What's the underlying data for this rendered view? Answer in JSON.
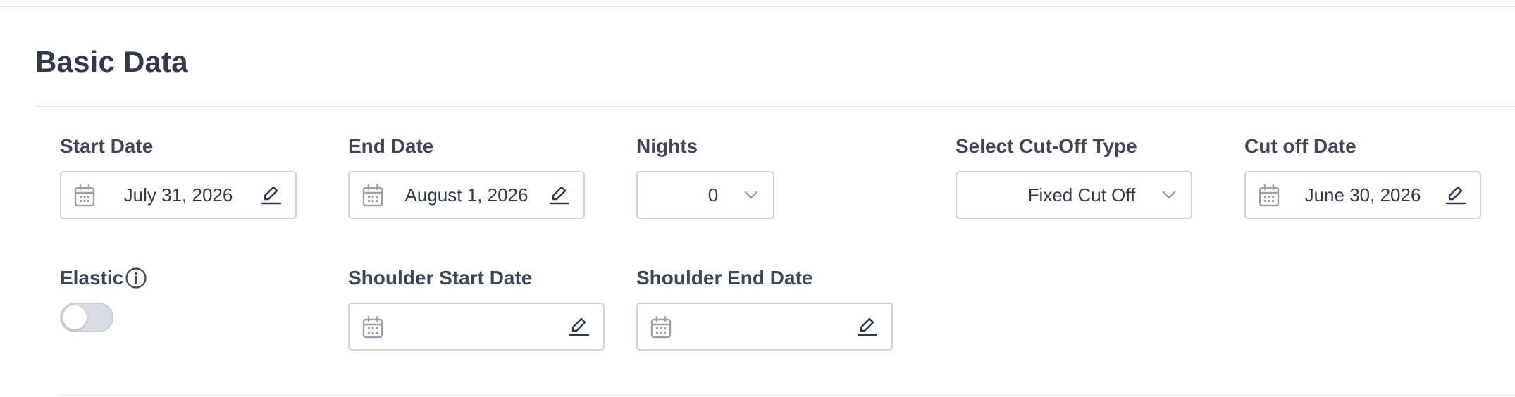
{
  "section": {
    "title": "Basic Data"
  },
  "fields": {
    "start_date": {
      "label": "Start Date",
      "value": "July 31, 2026"
    },
    "end_date": {
      "label": "End Date",
      "value": "August 1, 2026"
    },
    "nights": {
      "label": "Nights",
      "value": "0"
    },
    "cutoff_type": {
      "label": "Select Cut-Off Type",
      "value": "Fixed Cut Off"
    },
    "cutoff_date": {
      "label": "Cut off Date",
      "value": "June 30, 2026"
    },
    "elastic": {
      "label": "Elastic",
      "enabled": false
    },
    "shoulder_start_date": {
      "label": "Shoulder Start Date",
      "value": ""
    },
    "shoulder_end_date": {
      "label": "Shoulder End Date",
      "value": ""
    }
  },
  "icons": {
    "date_picker": "calendar-icon",
    "edit": "pencil-icon",
    "dropdown": "chevron-down-icon",
    "info": "info-icon"
  },
  "colors": {
    "text": "#3d4656",
    "border": "#cfd3d9",
    "icon": "#9aa1ac",
    "toggle_off": "#d9dde3"
  }
}
